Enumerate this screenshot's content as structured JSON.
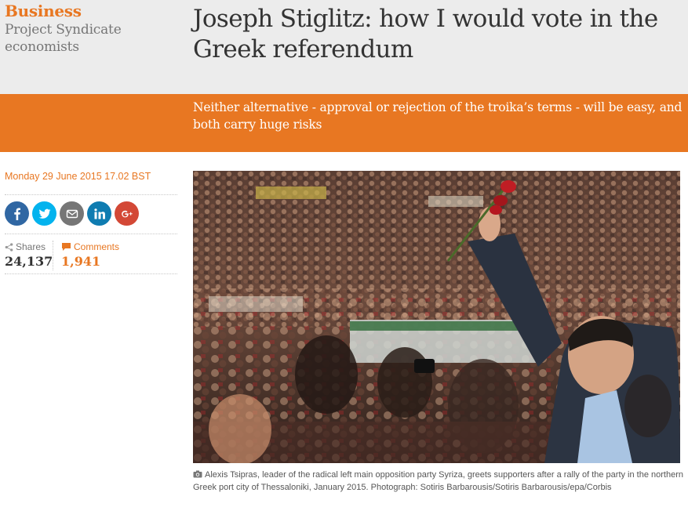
{
  "header": {
    "section": "Business",
    "series": "Project Syndicate economists",
    "headline": "Joseph Stiglitz: how I would vote in the Greek referendum"
  },
  "standfirst": "Neither alternative - approval or rejection of the troika’s terms - will be easy, and both carry huge risks",
  "meta": {
    "dateline": "Monday 29 June 2015 17.02 BST",
    "share_buttons": [
      {
        "name": "facebook",
        "icon": "facebook-icon",
        "color": "#3067a3"
      },
      {
        "name": "twitter",
        "icon": "twitter-icon",
        "color": "#03b3ee"
      },
      {
        "name": "email",
        "icon": "email-icon",
        "color": "#767676"
      },
      {
        "name": "linkedin",
        "icon": "linkedin-icon",
        "color": "#0f7cb1"
      },
      {
        "name": "google-plus",
        "icon": "google-plus-icon",
        "color": "#d34836"
      }
    ],
    "shares_label": "Shares",
    "shares_count": "24,137",
    "comments_label": "Comments",
    "comments_count": "1,941"
  },
  "figure": {
    "caption": "Alexis Tsipras, leader of the radical left main opposition party Syriza, greets supporters after a rally of the party in the northern Greek port city of Thessaloniki, January 2015. Photograph: Sotiris Barbarousis/Sotiris Barbarousis/epa/Corbis"
  },
  "colors": {
    "accent": "#e87722",
    "header_bg": "#ececec",
    "text": "#333333"
  }
}
